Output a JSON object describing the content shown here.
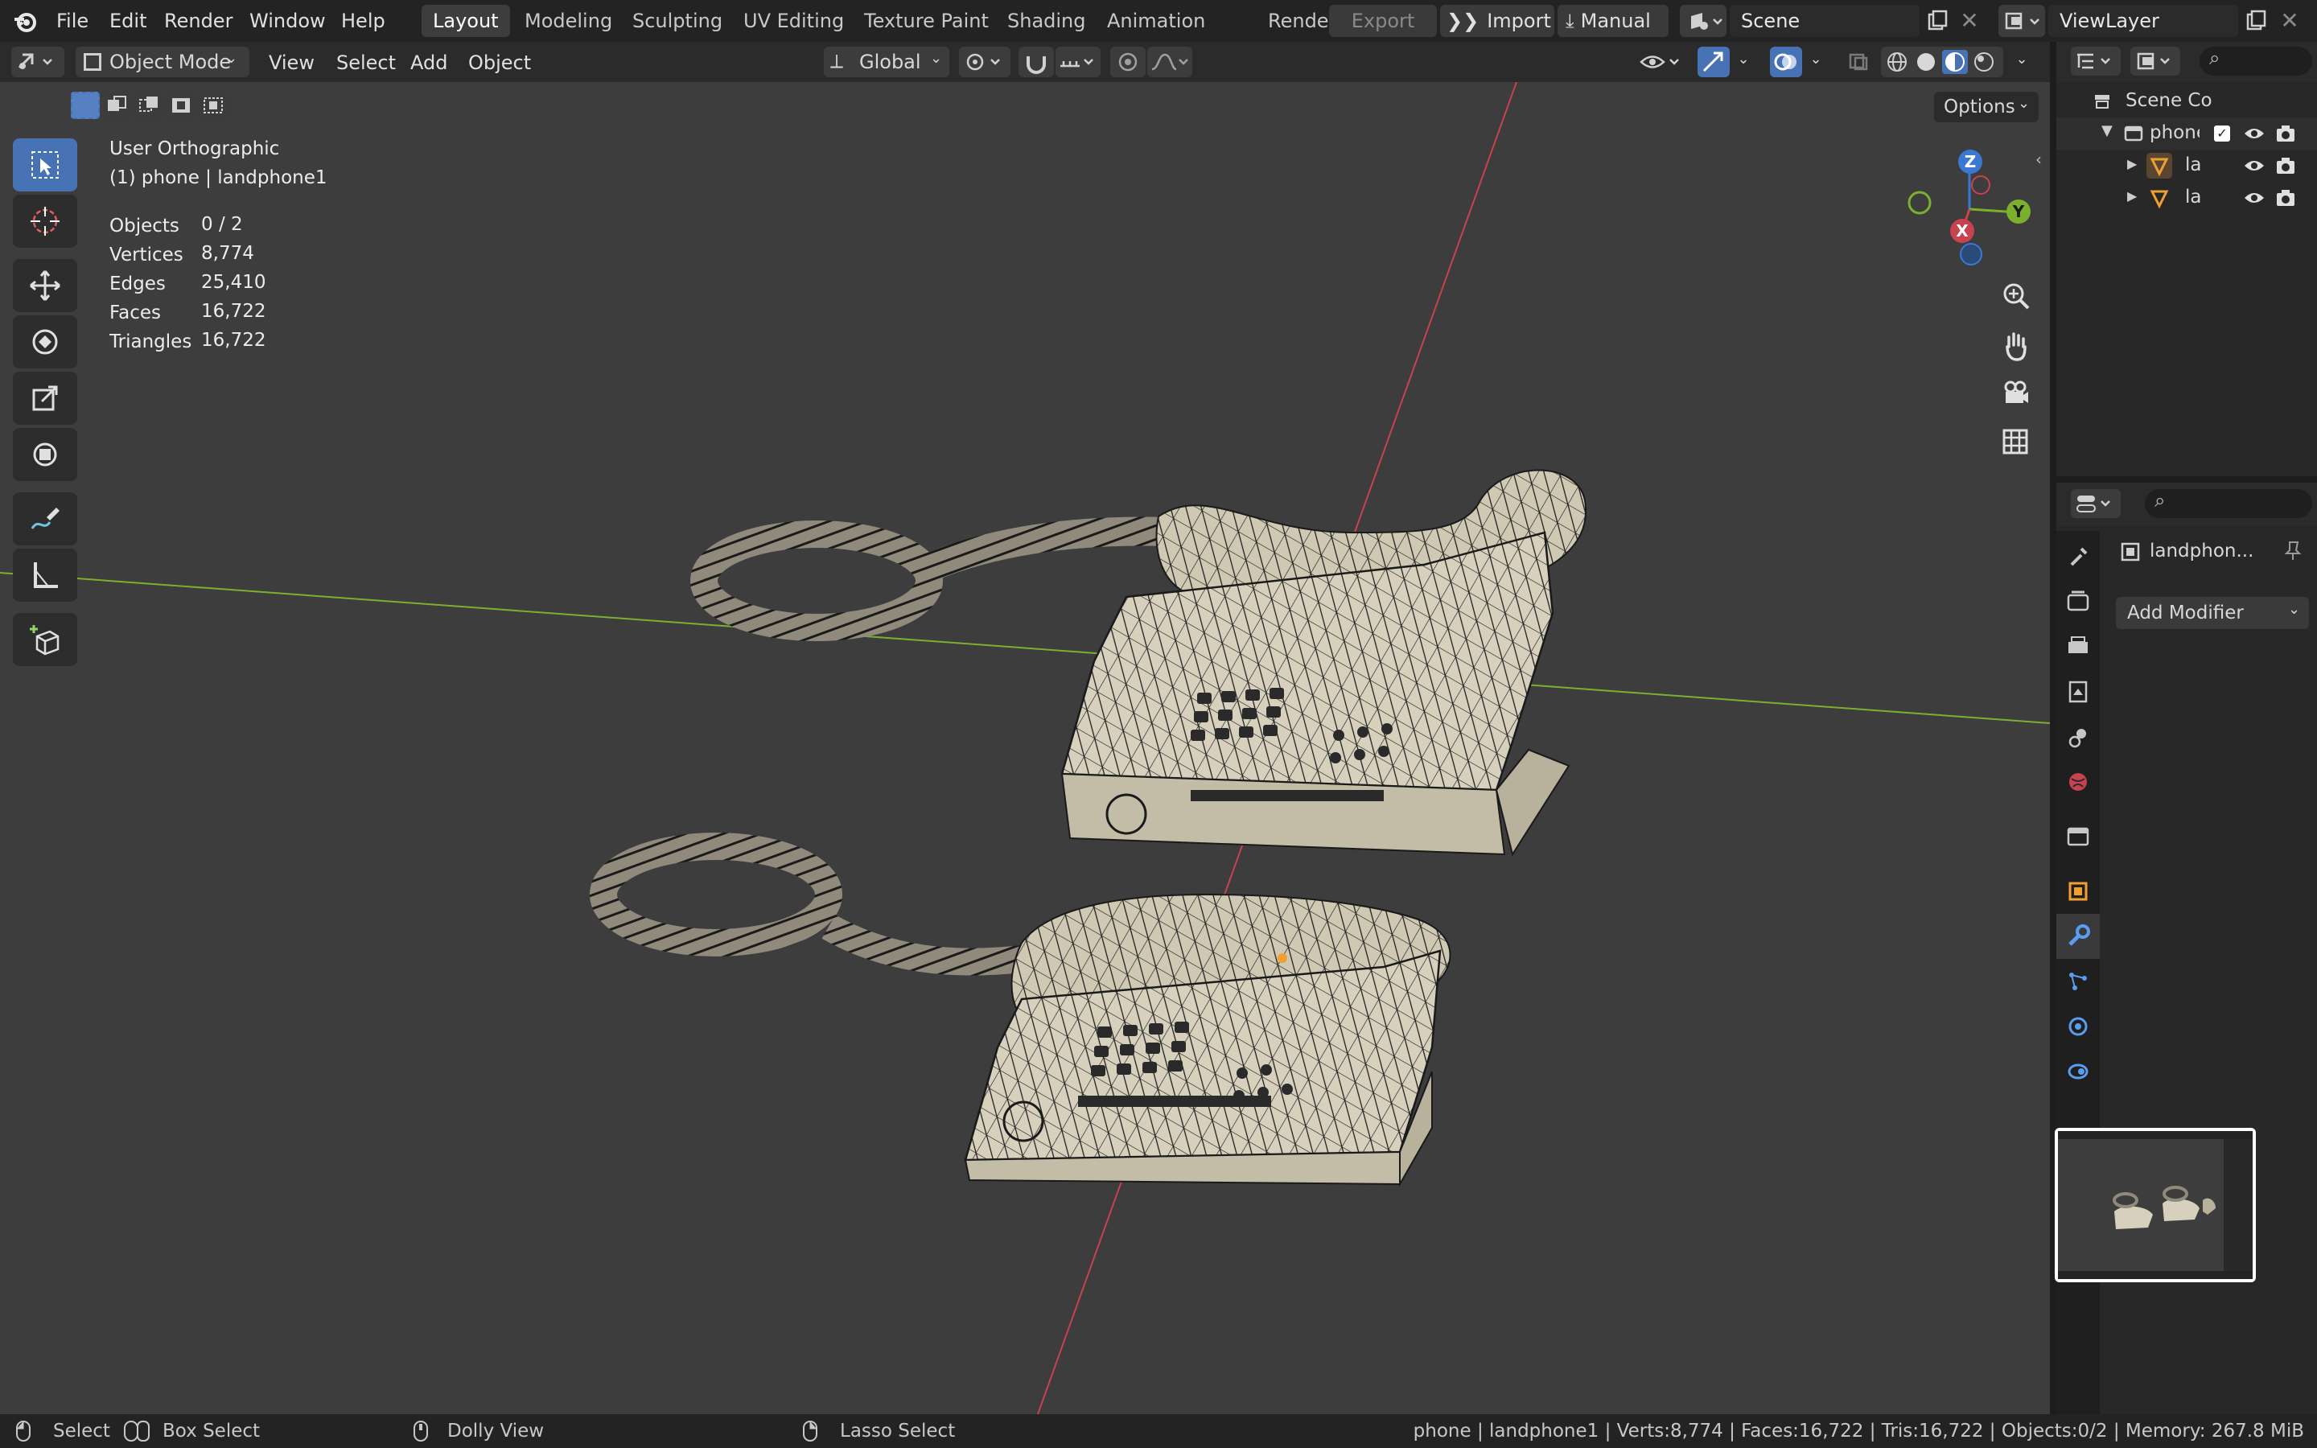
{
  "topbar": {
    "menus": [
      "File",
      "Edit",
      "Render",
      "Window",
      "Help"
    ],
    "workspace_tabs": [
      "Layout",
      "Modeling",
      "Sculpting",
      "UV Editing",
      "Texture Paint",
      "Shading",
      "Animation",
      "Rendering"
    ],
    "active_tab": "Layout",
    "export_label": "Export",
    "import_label": "Import",
    "manual_label": "Manual",
    "scene_name": "Scene",
    "view_layer": "ViewLayer"
  },
  "header": {
    "mode": "Object Mode",
    "menus": [
      "View",
      "Select",
      "Add",
      "Object"
    ],
    "transform_orientation": "Global",
    "options_label": "Options"
  },
  "viewport": {
    "view_name": "User Orthographic",
    "context": "(1) phone | landphone1",
    "stats": [
      {
        "label": "Objects",
        "value": "0 / 2"
      },
      {
        "label": "Vertices",
        "value": "8,774"
      },
      {
        "label": "Edges",
        "value": "25,410"
      },
      {
        "label": "Faces",
        "value": "16,722"
      },
      {
        "label": "Triangles",
        "value": "16,722"
      }
    ],
    "gizmo": {
      "x": "X",
      "y": "Y",
      "z": "Z"
    }
  },
  "outliner": {
    "root": "Scene Co",
    "collection": "phone",
    "items": [
      "la",
      "la"
    ]
  },
  "properties": {
    "object_name": "landphon...",
    "add_modifier": "Add Modifier"
  },
  "statusbar": {
    "select": "Select",
    "box_select": "Box Select",
    "dolly_view": "Dolly View",
    "lasso_select": "Lasso Select",
    "info": "phone | landphone1 | Verts:8,774 | Faces:16,722 | Tris:16,722 | Objects:0/2 | Memory: 267.8 MiB"
  },
  "colors": {
    "accent": "#4772b3",
    "axis_x": "#c8424f",
    "axis_y": "#7bb02c",
    "axis_z": "#3a78d4"
  }
}
